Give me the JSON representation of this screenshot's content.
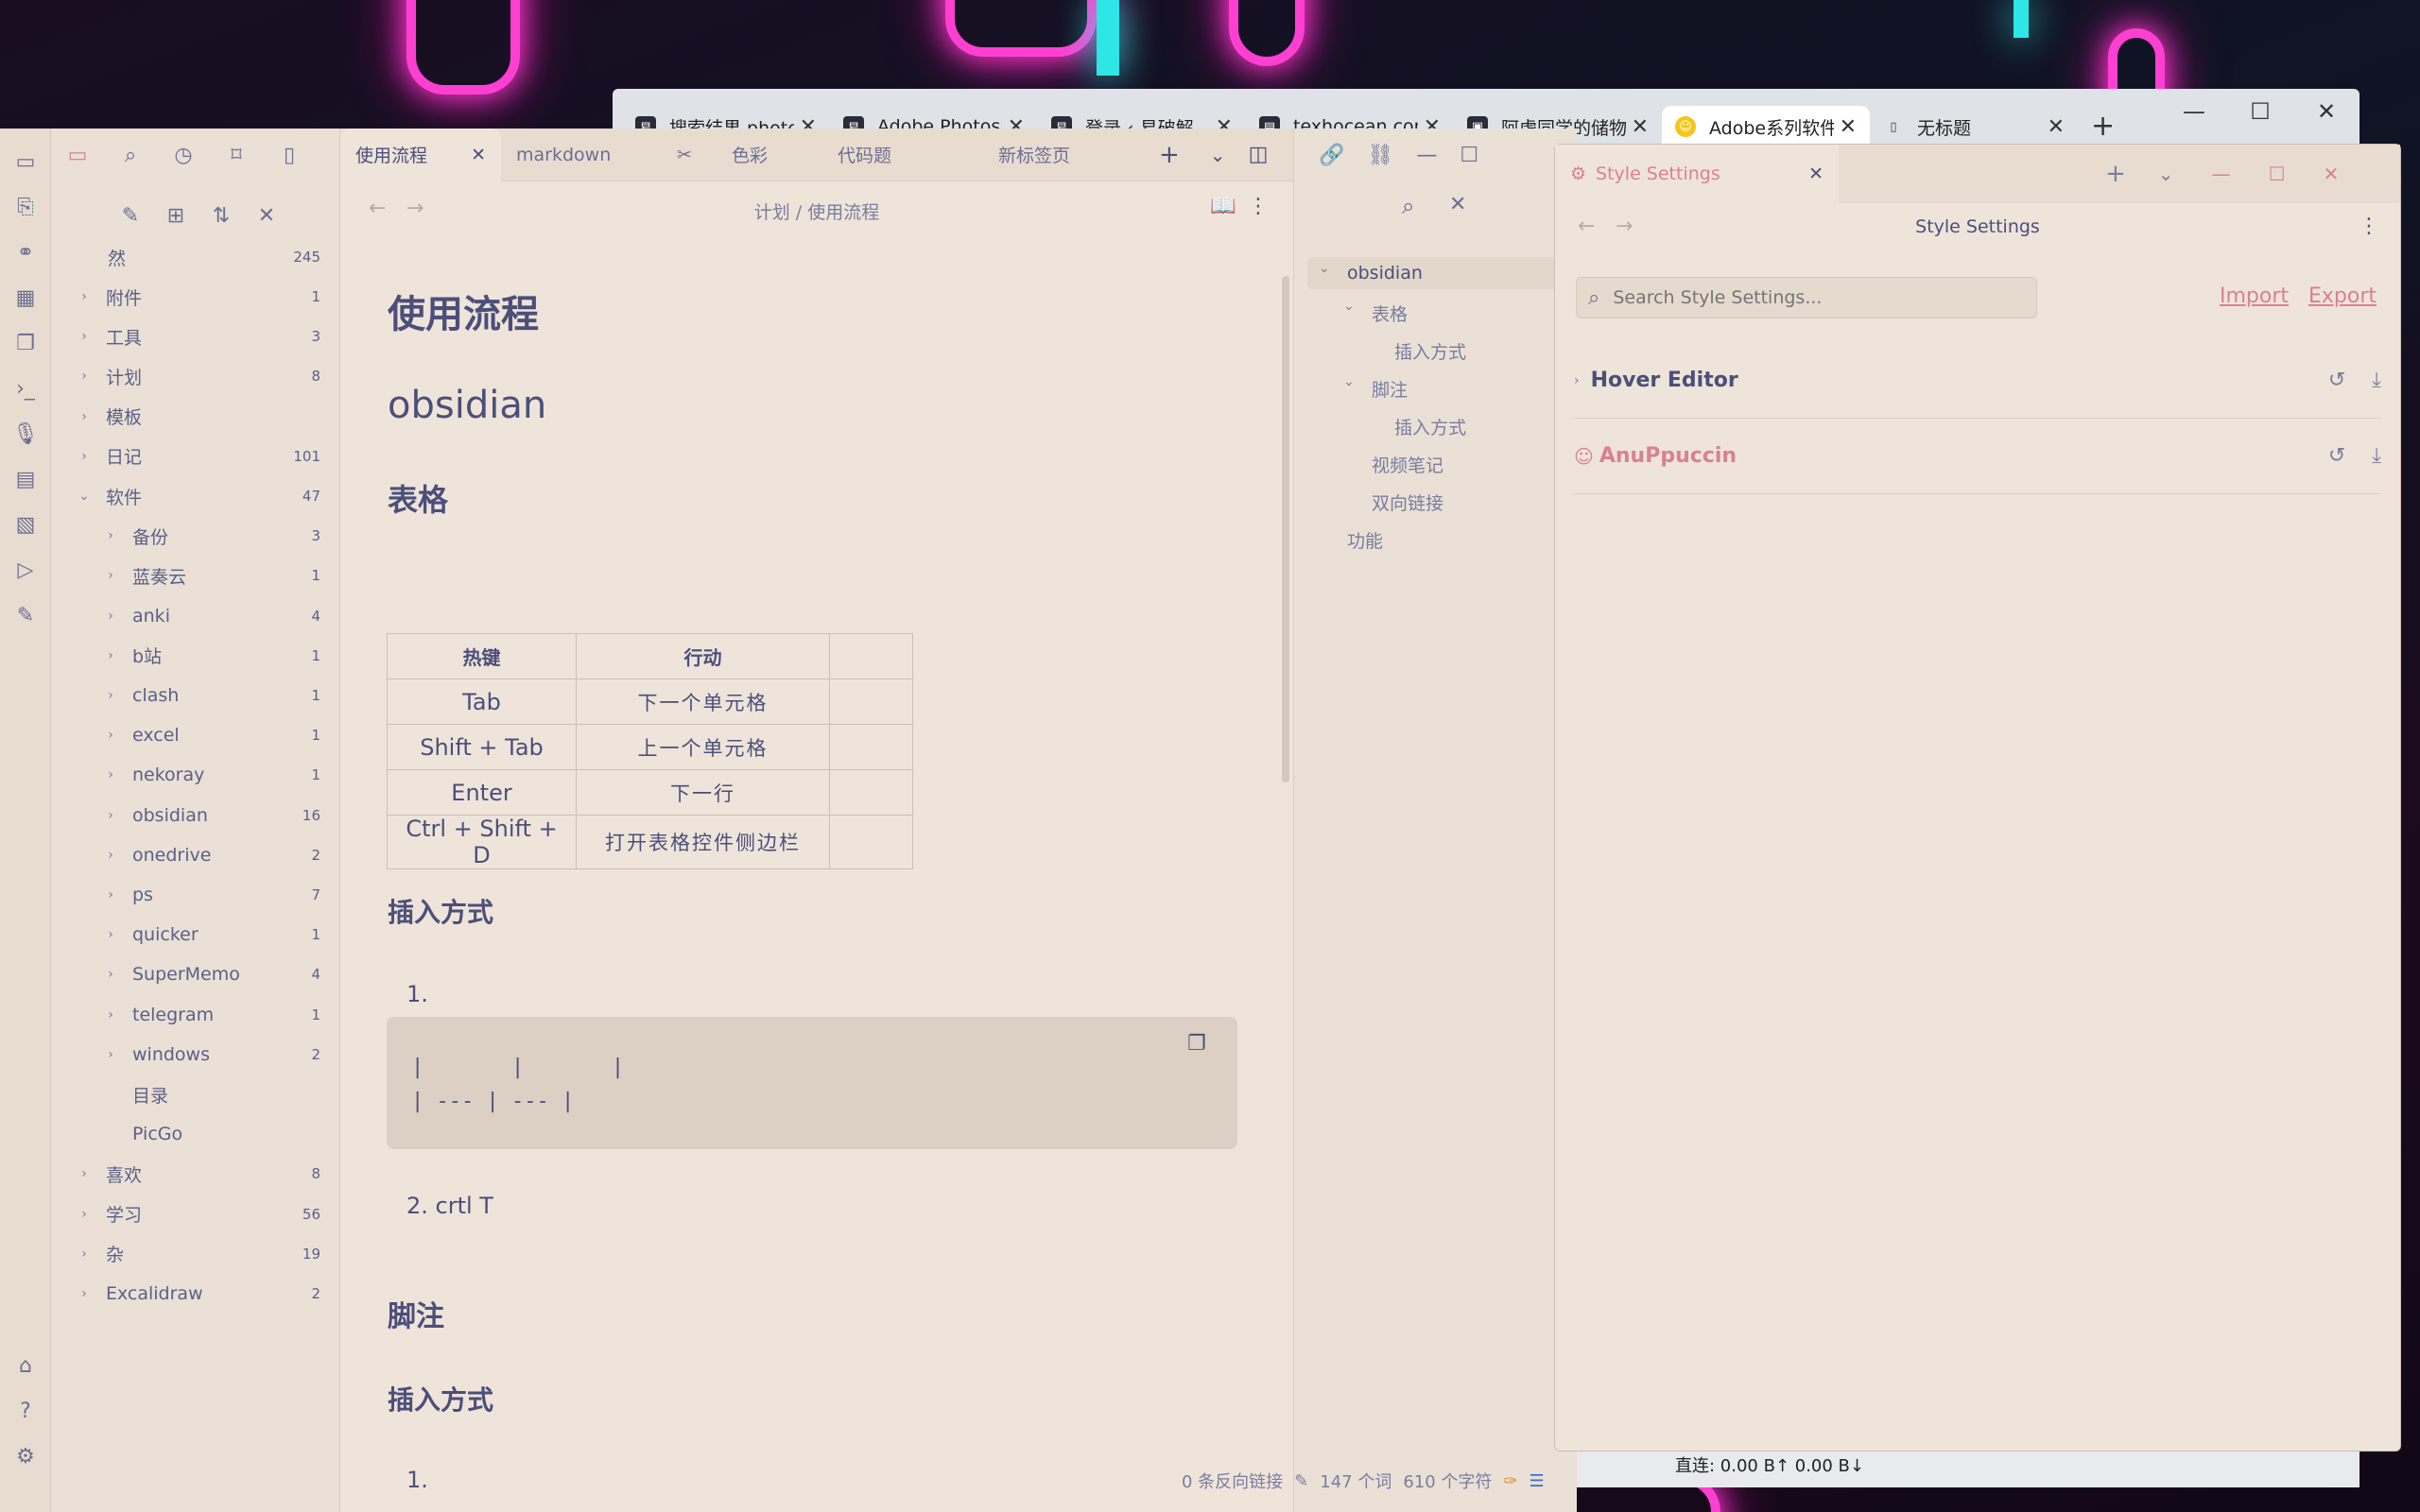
{
  "browser": {
    "tabs": [
      {
        "title": "搜索结果 photo",
        "icon": "易"
      },
      {
        "title": "Adobe Photoshop",
        "icon": "易"
      },
      {
        "title": "登录 ‹ 易破解",
        "icon": "易"
      },
      {
        "title": "texhocean.com",
        "icon": "doc"
      },
      {
        "title": "阿虚同学的储物",
        "icon": "img"
      },
      {
        "title": "Adobe系列软件",
        "icon": "smile",
        "active": true
      },
      {
        "title": "无标题",
        "icon": "page"
      }
    ],
    "status": "直连: 0.00 B↑ 0.00 B↓"
  },
  "explorer": {
    "root": {
      "name": "然",
      "count": "245"
    },
    "items": [
      {
        "name": "附件",
        "count": "1",
        "level": 0,
        "caret": "›"
      },
      {
        "name": "工具",
        "count": "3",
        "level": 0,
        "caret": "›"
      },
      {
        "name": "计划",
        "count": "8",
        "level": 0,
        "caret": "›"
      },
      {
        "name": "模板",
        "count": "",
        "level": 0,
        "caret": "›"
      },
      {
        "name": "日记",
        "count": "101",
        "level": 0,
        "caret": "›"
      },
      {
        "name": "软件",
        "count": "47",
        "level": 0,
        "caret": "⌄"
      },
      {
        "name": "备份",
        "count": "3",
        "level": 1,
        "caret": "›"
      },
      {
        "name": "蓝奏云",
        "count": "1",
        "level": 1,
        "caret": "›"
      },
      {
        "name": "anki",
        "count": "4",
        "level": 1,
        "caret": "›"
      },
      {
        "name": "b站",
        "count": "1",
        "level": 1,
        "caret": "›"
      },
      {
        "name": "clash",
        "count": "1",
        "level": 1,
        "caret": "›"
      },
      {
        "name": "excel",
        "count": "1",
        "level": 1,
        "caret": "›"
      },
      {
        "name": "nekoray",
        "count": "1",
        "level": 1,
        "caret": "›"
      },
      {
        "name": "obsidian",
        "count": "16",
        "level": 1,
        "caret": "›"
      },
      {
        "name": "onedrive",
        "count": "2",
        "level": 1,
        "caret": "›"
      },
      {
        "name": "ps",
        "count": "7",
        "level": 1,
        "caret": "›"
      },
      {
        "name": "quicker",
        "count": "1",
        "level": 1,
        "caret": "›"
      },
      {
        "name": "SuperMemo",
        "count": "4",
        "level": 1,
        "caret": "›"
      },
      {
        "name": "telegram",
        "count": "1",
        "level": 1,
        "caret": "›"
      },
      {
        "name": "windows",
        "count": "2",
        "level": 1,
        "caret": "›"
      },
      {
        "name": "目录",
        "count": "",
        "level": 1,
        "caret": ""
      },
      {
        "name": "PicGo",
        "count": "",
        "level": 1,
        "caret": ""
      },
      {
        "name": "喜欢",
        "count": "8",
        "level": 0,
        "caret": "›"
      },
      {
        "name": "学习",
        "count": "56",
        "level": 0,
        "caret": "›"
      },
      {
        "name": "杂",
        "count": "19",
        "level": 0,
        "caret": "›"
      },
      {
        "name": "Excalidraw",
        "count": "2",
        "level": 0,
        "caret": "›"
      }
    ]
  },
  "editor": {
    "tabs": [
      "使用流程",
      "markdown",
      "色彩",
      "代码题",
      "新标签页"
    ],
    "breadcrumb": "计划 / 使用流程",
    "title": "使用流程",
    "h_obsidian": "obsidian",
    "h_table": "表格",
    "table": {
      "headers": [
        "热键",
        "行动",
        ""
      ],
      "rows": [
        [
          "Tab",
          "下一个单元格",
          ""
        ],
        [
          "Shift + Tab",
          "上一个单元格",
          ""
        ],
        [
          "Enter",
          "下一行",
          ""
        ],
        [
          "Ctrl + Shift + D",
          "打开表格控件侧边栏",
          ""
        ]
      ]
    },
    "h_insert": "插入方式",
    "list1": "1.",
    "code": "|       |       |\n| --- | --- |",
    "list2": "2. crtl T",
    "h_footnote": "脚注",
    "h_insert2": "插入方式",
    "list3": "1."
  },
  "outline": {
    "items": [
      "obsidian",
      "表格",
      "插入方式",
      "脚注",
      "插入方式",
      "视频笔记",
      "双向链接",
      "功能"
    ]
  },
  "statusbar": {
    "backlinks": "0 条反向链接",
    "words": "147 个词",
    "chars": "610 个字符"
  },
  "style_settings": {
    "tab": "Style Settings",
    "title": "Style Settings",
    "search_placeholder": "Search Style Settings...",
    "import": "Import",
    "export": "Export",
    "rows": [
      "Hover Editor",
      "AnuPpuccin"
    ]
  },
  "colors": {
    "accent": "#d9818f",
    "text": "#4b4f7a",
    "bg": "#efe4da"
  }
}
